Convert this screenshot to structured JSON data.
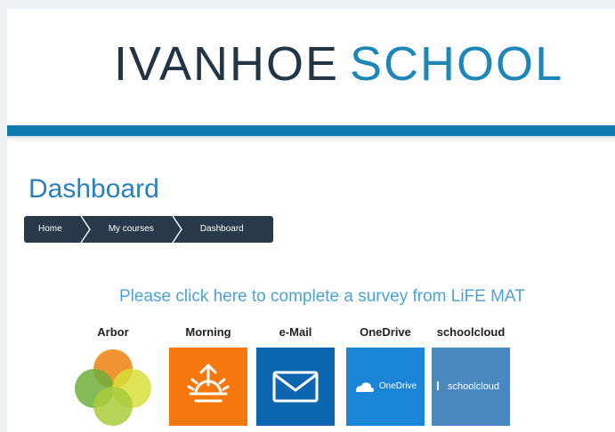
{
  "header": {
    "brand_word1": "IVANHOE",
    "brand_word2": "SCHOOL"
  },
  "page": {
    "title": "Dashboard"
  },
  "breadcrumb": {
    "items": [
      "Home",
      "My courses",
      "Dashboard"
    ]
  },
  "survey": {
    "text": "Please click here to complete a survey from LiFE MAT"
  },
  "tiles": [
    {
      "label": "Arbor",
      "icon": "arbor-logo-icon",
      "colors": [
        "#ef8a1e",
        "#8fc13e",
        "#d7df3a"
      ]
    },
    {
      "label": "Morning",
      "icon": "sunrise-icon",
      "color": "#f5780e"
    },
    {
      "label": "e-Mail",
      "icon": "envelope-icon",
      "color": "#0d66b0"
    },
    {
      "label": "OneDrive",
      "icon": "cloud-icon",
      "color": "#1b86d8",
      "box_text": "OneDrive"
    },
    {
      "label": "schoolcloud",
      "icon": "schoolcloud-logo-icon",
      "color": "#4a89c0",
      "box_text": "schoolcloud"
    }
  ],
  "colors": {
    "brand_dark": "#233444",
    "brand_blue": "#1f86b8",
    "header_bar": "#0d7ab0",
    "title_blue": "#2d7fb8",
    "breadcrumb_bg": "#27394a",
    "survey_link": "#4fa3d3"
  }
}
